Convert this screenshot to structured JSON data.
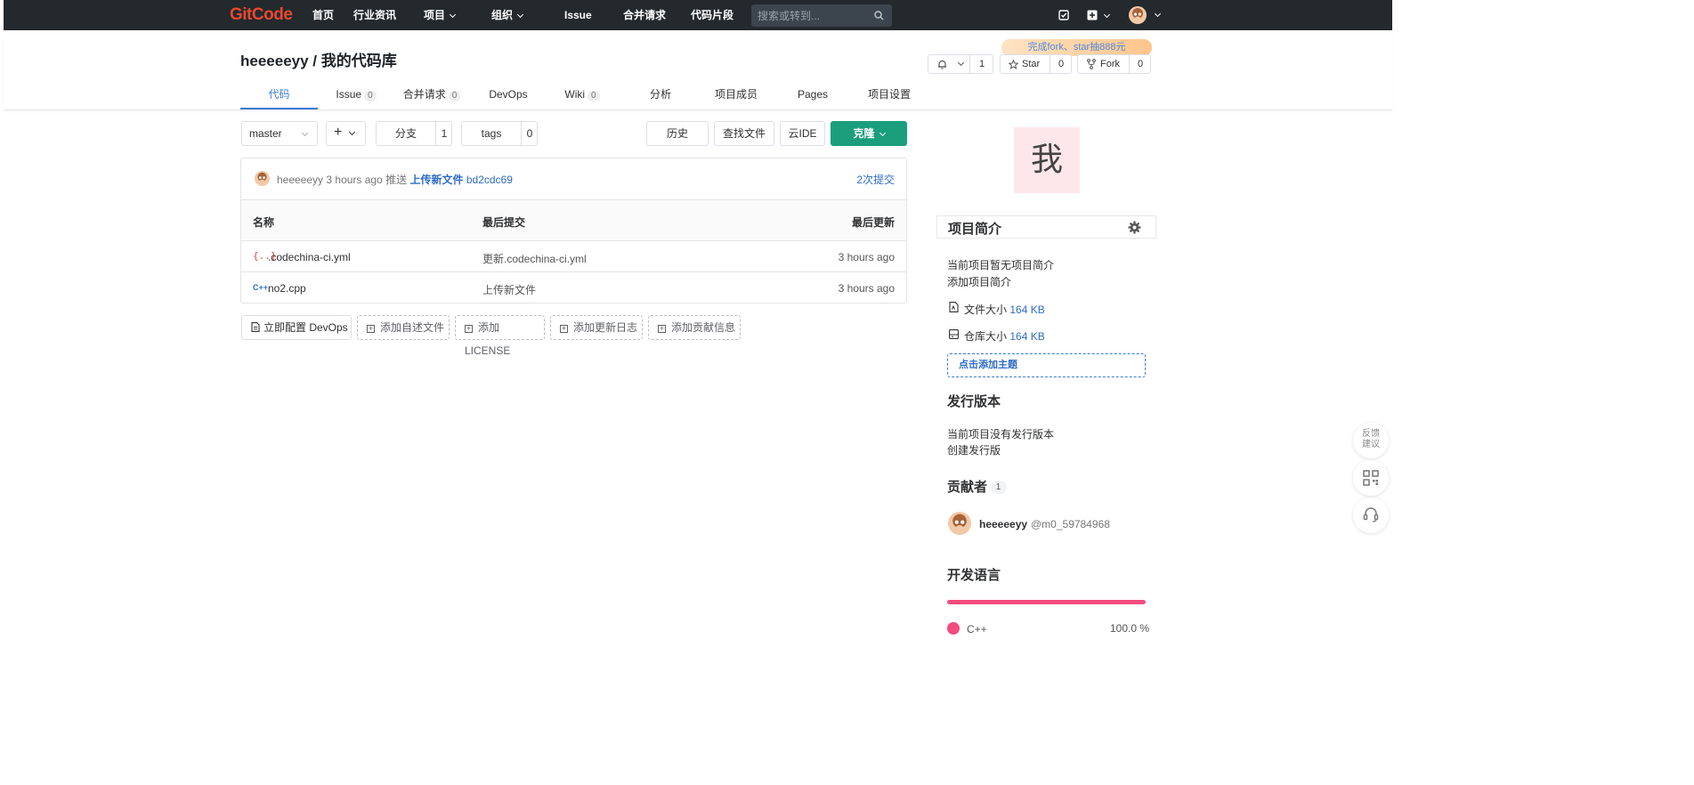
{
  "nav": {
    "logo": "GitCode",
    "items": [
      "首页",
      "行业资讯",
      "项目",
      "组织",
      "Issue",
      "合并请求",
      "代码片段"
    ],
    "search_placeholder": "搜索或转到..."
  },
  "repo": {
    "owner": "heeeeeyy",
    "separator": " / ",
    "name": "我的代码库",
    "promo": "完成fork、star抽888元",
    "watch_count": "1",
    "star_label": "Star",
    "star_count": "0",
    "fork_label": "Fork",
    "fork_count": "0"
  },
  "tabs": [
    {
      "label": "代码",
      "count": ""
    },
    {
      "label": "Issue",
      "count": "0"
    },
    {
      "label": "合并请求",
      "count": "0"
    },
    {
      "label": "DevOps",
      "count": ""
    },
    {
      "label": "Wiki",
      "count": "0"
    },
    {
      "label": "分析",
      "count": ""
    },
    {
      "label": "项目成员",
      "count": ""
    },
    {
      "label": "Pages",
      "count": ""
    },
    {
      "label": "项目设置",
      "count": ""
    }
  ],
  "toolbar": {
    "branch": "master",
    "branches_label": "分支",
    "branches_count": "1",
    "tags_label": "tags",
    "tags_count": "0",
    "history": "历史",
    "find_file": "查找文件",
    "cloud_ide": "云IDE",
    "clone": "克隆"
  },
  "commit": {
    "author": "heeeeeyy",
    "time": "3 hours ago",
    "action": "推送",
    "message": "上传新文件",
    "hash": "bd2cdc69",
    "count_label": "2次提交"
  },
  "table": {
    "headers": [
      "名称",
      "最后提交",
      "最后更新"
    ],
    "rows": [
      {
        "icon": "{..}",
        "name": ".codechina-ci.yml",
        "commit": "更新.codechina-ci.yml",
        "updated": "3 hours ago"
      },
      {
        "icon": "C++",
        "name": "no2.cpp",
        "commit": "上传新文件",
        "updated": "3 hours ago"
      }
    ]
  },
  "actions": [
    "立即配置 DevOps",
    "添加自述文件",
    "添加LICENSE",
    "添加更新日志",
    "添加贡献信息"
  ],
  "sidebar": {
    "avatar_char": "我",
    "intro_title": "项目简介",
    "intro_empty": "当前项目暂无项目简介",
    "intro_add": "添加项目简介",
    "file_size_label": "文件大小",
    "file_size": "164 KB",
    "repo_size_label": "仓库大小",
    "repo_size": "164 KB",
    "add_topic": "点击添加主题",
    "release_title": "发行版本",
    "release_empty": "当前项目没有发行版本",
    "release_create": "创建发行版",
    "contrib_title": "贡献者",
    "contrib_count": "1",
    "contrib_name": "heeeeeyy",
    "contrib_handle": "@m0_59784968",
    "lang_title": "开发语言",
    "lang_name": "C++",
    "lang_percent": "100.0 %",
    "lang_share": 1.0,
    "lang_color": "#f34b7d"
  },
  "float": {
    "feedback": "反馈建议"
  },
  "colors": {
    "accent": "#3c7bd8",
    "clone": "#1a9e7b",
    "nav": "#24292e"
  }
}
